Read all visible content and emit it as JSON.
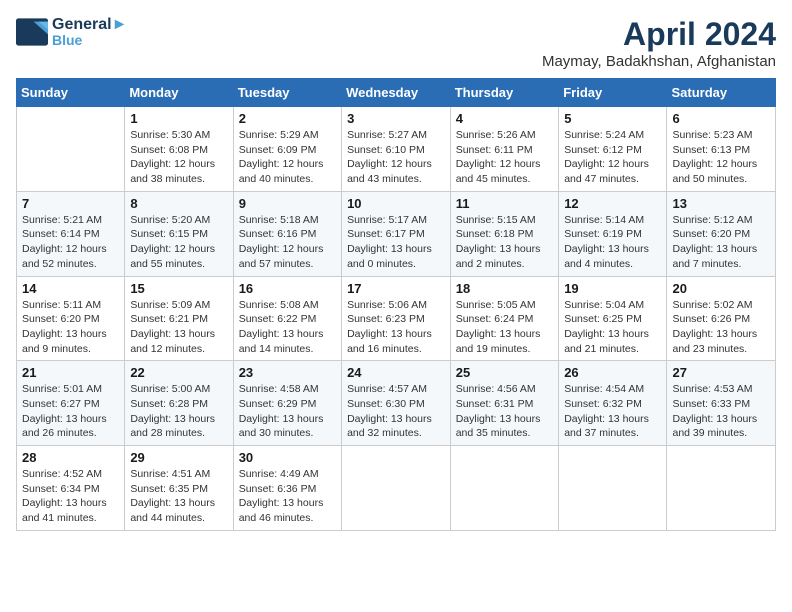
{
  "header": {
    "logo_line1": "General",
    "logo_line2": "Blue",
    "month": "April 2024",
    "location": "Maymay, Badakhshan, Afghanistan"
  },
  "weekdays": [
    "Sunday",
    "Monday",
    "Tuesday",
    "Wednesday",
    "Thursday",
    "Friday",
    "Saturday"
  ],
  "weeks": [
    [
      {
        "day": "",
        "sunrise": "",
        "sunset": "",
        "daylight": ""
      },
      {
        "day": "1",
        "sunrise": "Sunrise: 5:30 AM",
        "sunset": "Sunset: 6:08 PM",
        "daylight": "Daylight: 12 hours and 38 minutes."
      },
      {
        "day": "2",
        "sunrise": "Sunrise: 5:29 AM",
        "sunset": "Sunset: 6:09 PM",
        "daylight": "Daylight: 12 hours and 40 minutes."
      },
      {
        "day": "3",
        "sunrise": "Sunrise: 5:27 AM",
        "sunset": "Sunset: 6:10 PM",
        "daylight": "Daylight: 12 hours and 43 minutes."
      },
      {
        "day": "4",
        "sunrise": "Sunrise: 5:26 AM",
        "sunset": "Sunset: 6:11 PM",
        "daylight": "Daylight: 12 hours and 45 minutes."
      },
      {
        "day": "5",
        "sunrise": "Sunrise: 5:24 AM",
        "sunset": "Sunset: 6:12 PM",
        "daylight": "Daylight: 12 hours and 47 minutes."
      },
      {
        "day": "6",
        "sunrise": "Sunrise: 5:23 AM",
        "sunset": "Sunset: 6:13 PM",
        "daylight": "Daylight: 12 hours and 50 minutes."
      }
    ],
    [
      {
        "day": "7",
        "sunrise": "Sunrise: 5:21 AM",
        "sunset": "Sunset: 6:14 PM",
        "daylight": "Daylight: 12 hours and 52 minutes."
      },
      {
        "day": "8",
        "sunrise": "Sunrise: 5:20 AM",
        "sunset": "Sunset: 6:15 PM",
        "daylight": "Daylight: 12 hours and 55 minutes."
      },
      {
        "day": "9",
        "sunrise": "Sunrise: 5:18 AM",
        "sunset": "Sunset: 6:16 PM",
        "daylight": "Daylight: 12 hours and 57 minutes."
      },
      {
        "day": "10",
        "sunrise": "Sunrise: 5:17 AM",
        "sunset": "Sunset: 6:17 PM",
        "daylight": "Daylight: 13 hours and 0 minutes."
      },
      {
        "day": "11",
        "sunrise": "Sunrise: 5:15 AM",
        "sunset": "Sunset: 6:18 PM",
        "daylight": "Daylight: 13 hours and 2 minutes."
      },
      {
        "day": "12",
        "sunrise": "Sunrise: 5:14 AM",
        "sunset": "Sunset: 6:19 PM",
        "daylight": "Daylight: 13 hours and 4 minutes."
      },
      {
        "day": "13",
        "sunrise": "Sunrise: 5:12 AM",
        "sunset": "Sunset: 6:20 PM",
        "daylight": "Daylight: 13 hours and 7 minutes."
      }
    ],
    [
      {
        "day": "14",
        "sunrise": "Sunrise: 5:11 AM",
        "sunset": "Sunset: 6:20 PM",
        "daylight": "Daylight: 13 hours and 9 minutes."
      },
      {
        "day": "15",
        "sunrise": "Sunrise: 5:09 AM",
        "sunset": "Sunset: 6:21 PM",
        "daylight": "Daylight: 13 hours and 12 minutes."
      },
      {
        "day": "16",
        "sunrise": "Sunrise: 5:08 AM",
        "sunset": "Sunset: 6:22 PM",
        "daylight": "Daylight: 13 hours and 14 minutes."
      },
      {
        "day": "17",
        "sunrise": "Sunrise: 5:06 AM",
        "sunset": "Sunset: 6:23 PM",
        "daylight": "Daylight: 13 hours and 16 minutes."
      },
      {
        "day": "18",
        "sunrise": "Sunrise: 5:05 AM",
        "sunset": "Sunset: 6:24 PM",
        "daylight": "Daylight: 13 hours and 19 minutes."
      },
      {
        "day": "19",
        "sunrise": "Sunrise: 5:04 AM",
        "sunset": "Sunset: 6:25 PM",
        "daylight": "Daylight: 13 hours and 21 minutes."
      },
      {
        "day": "20",
        "sunrise": "Sunrise: 5:02 AM",
        "sunset": "Sunset: 6:26 PM",
        "daylight": "Daylight: 13 hours and 23 minutes."
      }
    ],
    [
      {
        "day": "21",
        "sunrise": "Sunrise: 5:01 AM",
        "sunset": "Sunset: 6:27 PM",
        "daylight": "Daylight: 13 hours and 26 minutes."
      },
      {
        "day": "22",
        "sunrise": "Sunrise: 5:00 AM",
        "sunset": "Sunset: 6:28 PM",
        "daylight": "Daylight: 13 hours and 28 minutes."
      },
      {
        "day": "23",
        "sunrise": "Sunrise: 4:58 AM",
        "sunset": "Sunset: 6:29 PM",
        "daylight": "Daylight: 13 hours and 30 minutes."
      },
      {
        "day": "24",
        "sunrise": "Sunrise: 4:57 AM",
        "sunset": "Sunset: 6:30 PM",
        "daylight": "Daylight: 13 hours and 32 minutes."
      },
      {
        "day": "25",
        "sunrise": "Sunrise: 4:56 AM",
        "sunset": "Sunset: 6:31 PM",
        "daylight": "Daylight: 13 hours and 35 minutes."
      },
      {
        "day": "26",
        "sunrise": "Sunrise: 4:54 AM",
        "sunset": "Sunset: 6:32 PM",
        "daylight": "Daylight: 13 hours and 37 minutes."
      },
      {
        "day": "27",
        "sunrise": "Sunrise: 4:53 AM",
        "sunset": "Sunset: 6:33 PM",
        "daylight": "Daylight: 13 hours and 39 minutes."
      }
    ],
    [
      {
        "day": "28",
        "sunrise": "Sunrise: 4:52 AM",
        "sunset": "Sunset: 6:34 PM",
        "daylight": "Daylight: 13 hours and 41 minutes."
      },
      {
        "day": "29",
        "sunrise": "Sunrise: 4:51 AM",
        "sunset": "Sunset: 6:35 PM",
        "daylight": "Daylight: 13 hours and 44 minutes."
      },
      {
        "day": "30",
        "sunrise": "Sunrise: 4:49 AM",
        "sunset": "Sunset: 6:36 PM",
        "daylight": "Daylight: 13 hours and 46 minutes."
      },
      {
        "day": "",
        "sunrise": "",
        "sunset": "",
        "daylight": ""
      },
      {
        "day": "",
        "sunrise": "",
        "sunset": "",
        "daylight": ""
      },
      {
        "day": "",
        "sunrise": "",
        "sunset": "",
        "daylight": ""
      },
      {
        "day": "",
        "sunrise": "",
        "sunset": "",
        "daylight": ""
      }
    ]
  ]
}
